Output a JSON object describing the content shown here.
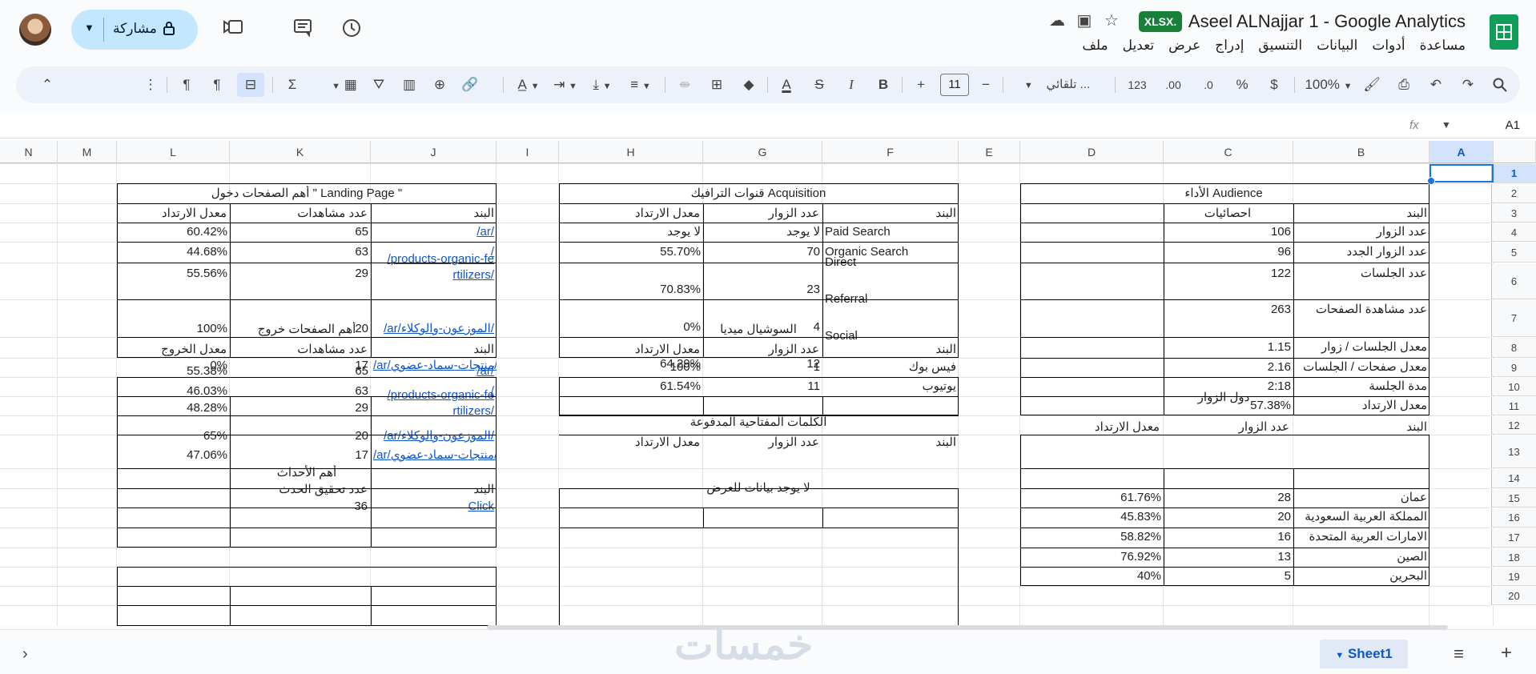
{
  "header": {
    "title": "Aseel ALNajjar 1 - Google Analytics",
    "file_badge": "XLSX.",
    "menus": [
      "ملف",
      "تعديل",
      "عرض",
      "إدراج",
      "التنسيق",
      "البيانات",
      "أدوات",
      "مساعدة"
    ],
    "share_label": "مشاركة"
  },
  "toolbar": {
    "zoom": "100%",
    "currency": "$",
    "percent": "%",
    "dec_decrease": ".0",
    "dec_increase": ".00",
    "number_format": "123",
    "font": "تلقائي ...",
    "font_size": "11",
    "minus": "−",
    "plus": "+",
    "bold": "B",
    "italic": "I",
    "strike": "S",
    "text_color": "A",
    "sum": "Σ",
    "more": "⋮"
  },
  "formula_bar": {
    "cell_ref": "A1",
    "fx": "fx"
  },
  "columns": [
    "A",
    "B",
    "C",
    "D",
    "E",
    "F",
    "G",
    "H",
    "I",
    "J",
    "K",
    "L",
    "M",
    "N"
  ],
  "rows": [
    "1",
    "2",
    "3",
    "4",
    "5",
    "6",
    "7",
    "8",
    "9",
    "10",
    "11",
    "12",
    "13",
    "14",
    "15",
    "16",
    "17",
    "18",
    "19",
    "20"
  ],
  "audience": {
    "title": "الأداء Audience",
    "h_item": "البند",
    "h_stat": "احصائيات",
    "rows": [
      {
        "item": "عدد الزوار",
        "val": "106"
      },
      {
        "item": "عدد الزوار الجدد",
        "val": "96"
      },
      {
        "item": "عدد الجلسات",
        "val": "122"
      },
      {
        "item": "عدد مشاهدة الصفحات",
        "val": "263"
      },
      {
        "item": "معدل الجلسات / زوار",
        "val": "1.15"
      },
      {
        "item": "معدل صفحات / الجلسات",
        "val": "2.16"
      },
      {
        "item": "مدة الجلسة",
        "val": "2:18"
      },
      {
        "item": "معدل الارتداد",
        "val": "57.38%"
      }
    ]
  },
  "countries": {
    "title": "دول الزوار",
    "h_item": "البند",
    "h_visitors": "عدد الزوار",
    "h_bounce": "معدل الارتداد",
    "rows": [
      {
        "item": "عمان",
        "visitors": "28",
        "bounce": "61.76%"
      },
      {
        "item": "المملكة العربية السعودية",
        "visitors": "20",
        "bounce": "45.83%"
      },
      {
        "item": "الامارات العربية المتحدة",
        "visitors": "16",
        "bounce": "58.82%"
      },
      {
        "item": "الصين",
        "visitors": "13",
        "bounce": "76.92%"
      },
      {
        "item": "البحرين",
        "visitors": "5",
        "bounce": "40%"
      }
    ]
  },
  "acquisition": {
    "title": "قنوات الترافيك Acquisition",
    "h_item": "البند",
    "h_visitors": "عدد الزوار",
    "h_bounce": "معدل الارتداد",
    "rows": [
      {
        "item": "Paid Search",
        "visitors": "لا يوجد",
        "bounce": "لا يوجد"
      },
      {
        "item": "Organic Search",
        "visitors": "70",
        "bounce": "55.70%"
      },
      {
        "item": "Direct",
        "visitors": "23",
        "bounce": "70.83%"
      },
      {
        "item": "Referral",
        "visitors": "4",
        "bounce": "0%"
      },
      {
        "item": "Social",
        "visitors": "12",
        "bounce": "64.29%"
      }
    ]
  },
  "social": {
    "title": "السوشيال ميديا",
    "h_item": "البند",
    "h_visitors": "عدد الزوار",
    "h_bounce": "معدل الارتداد",
    "rows": [
      {
        "item": "فيس بوك",
        "visitors": "1",
        "bounce": "100%"
      },
      {
        "item": "يوتيوب",
        "visitors": "11",
        "bounce": "61.54%"
      }
    ]
  },
  "paid_keywords": {
    "title": "الكلمات المفتاحية المدفوعة",
    "h_item": "البند",
    "h_visitors": "عدد الزوار",
    "h_bounce": "معدل الارتداد",
    "empty": "لا يوجد بيانات للعرض"
  },
  "landing": {
    "title": "أهم الصفحات دخول \" Landing Page \"",
    "h_item": "البند",
    "h_views": "عدد مشاهدات",
    "h_bounce": "معدل الارتداد",
    "rows": [
      {
        "page": "/ar/",
        "views": "65",
        "rate": "60.42%"
      },
      {
        "page": "/",
        "views": "63",
        "rate": "44.68%"
      },
      {
        "page": "/products-organic-fe",
        "page2": "rtilizers/",
        "views": "29",
        "rate": "55.56%"
      },
      {
        "page": "/ar/الموزعون-والوكلاء/",
        "views": "20",
        "rate": "100%"
      },
      {
        "page": "/ar/منتجات-سماد-عضوي/",
        "views": "17",
        "rate": "0%"
      }
    ]
  },
  "exit": {
    "title": "أهم الصفحات خروج",
    "h_item": "البند",
    "h_views": "عدد مشاهدات",
    "h_exit": "معدل الخروج",
    "rows": [
      {
        "page": "/ar/",
        "views": "65",
        "rate": "55.38%"
      },
      {
        "page": "/",
        "views": "63",
        "rate": "46.03%"
      },
      {
        "page": "/products-organic-fe",
        "page2": "rtilizers/",
        "views": "29",
        "rate": "48.28%"
      },
      {
        "page": "/ar/الموزعون-والوكلاء/",
        "views": "20",
        "rate": "65%"
      },
      {
        "page": "/ar/منتجات-سماد-عضوي/",
        "views": "17",
        "rate": "47.06%"
      }
    ]
  },
  "events": {
    "title": "أهم الأحداث",
    "h_item": "البند",
    "h_count": "عدد تحقيق الحدث",
    "rows": [
      {
        "item": "Click",
        "count": "36"
      }
    ]
  },
  "sheets": [
    {
      "name": "Sheet1"
    }
  ],
  "watermark": "خمسات",
  "colors": {
    "accent": "#0b57d0",
    "share_bg": "#c2e7ff",
    "xlsx_bg": "#188038",
    "link": "#1155cc"
  }
}
